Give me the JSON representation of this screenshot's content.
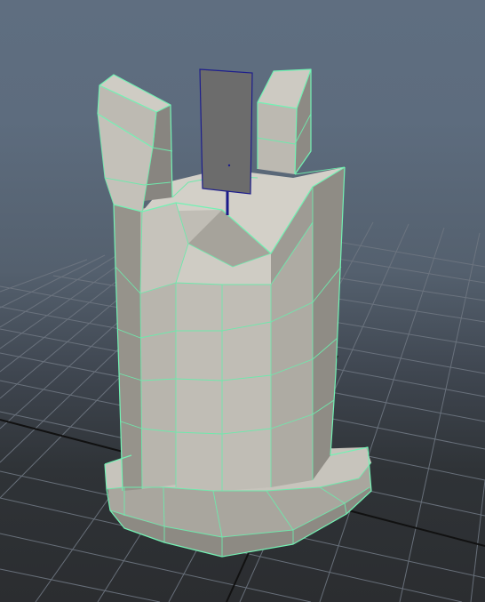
{
  "viewport": {
    "panel": "perspective-viewport",
    "background_top": "#5f6e80",
    "background_bottom": "#2b2d30",
    "grid": "on",
    "grid_line_color": "#6e7681",
    "axis_line_color": "#111111"
  },
  "scene": {
    "object": "castle-tower-mesh",
    "selection": "polygon-wireframe-highlighted",
    "face_color": "#b3b0a8",
    "wire_color": "#73f2b4",
    "flag_color": "#6c6c6c",
    "flag_outline_color": "#1e1e8c",
    "flag_pole_color": "#1a1a8a"
  }
}
